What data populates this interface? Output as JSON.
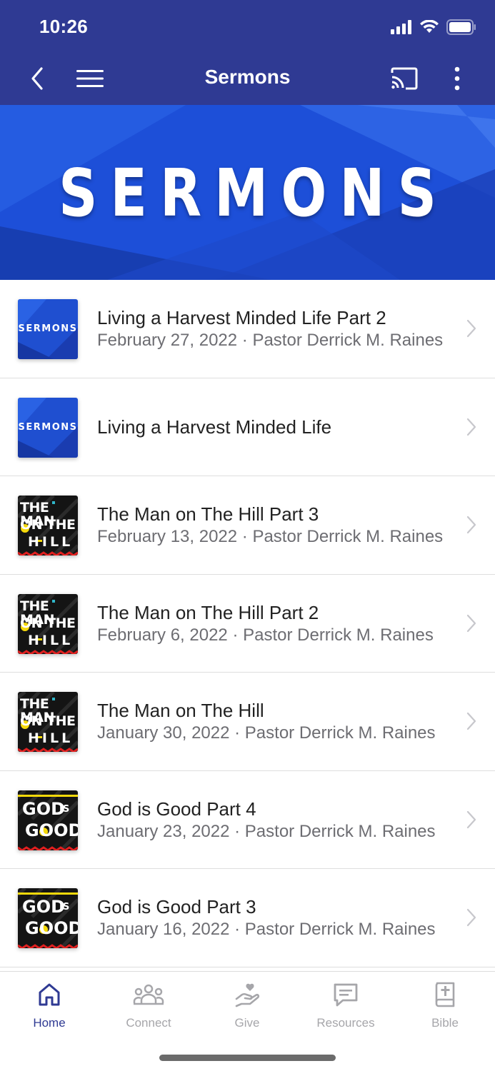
{
  "status_bar": {
    "time": "10:26"
  },
  "nav": {
    "title": "Sermons"
  },
  "banner": {
    "title": "SERMONS"
  },
  "thumbs": {
    "sermons_label": "SERMONS",
    "man_on_hill": {
      "line1": "THE MAN",
      "line2": "ON THE",
      "line3": "HILL"
    },
    "god_is_good": {
      "line1": "GOD",
      "is": "IS",
      "line2": "GOOD"
    }
  },
  "sermons": [
    {
      "title": "Living a Harvest Minded Life Part 2",
      "subtitle": "February 27, 2022 · Pastor Derrick M. Raines",
      "thumb": "sermons"
    },
    {
      "title": "Living a Harvest Minded Life",
      "subtitle": "",
      "thumb": "sermons"
    },
    {
      "title": "The Man on The Hill Part 3",
      "subtitle": "February 13, 2022 · Pastor Derrick M. Raines",
      "thumb": "man-on-hill"
    },
    {
      "title": "The Man on The Hill Part 2",
      "subtitle": "February 6, 2022 · Pastor Derrick M. Raines",
      "thumb": "man-on-hill"
    },
    {
      "title": "The Man on The Hill",
      "subtitle": "January 30, 2022 · Pastor Derrick M. Raines",
      "thumb": "man-on-hill"
    },
    {
      "title": "God is Good Part 4",
      "subtitle": "January 23, 2022 · Pastor Derrick M. Raines",
      "thumb": "god-is-good"
    },
    {
      "title": "God is Good Part 3",
      "subtitle": "January 16, 2022 · Pastor Derrick M. Raines",
      "thumb": "god-is-good"
    }
  ],
  "tabs": [
    {
      "label": "Home",
      "icon": "home-icon",
      "active": true
    },
    {
      "label": "Connect",
      "icon": "people-icon",
      "active": false
    },
    {
      "label": "Give",
      "icon": "give-heart-hand-icon",
      "active": false
    },
    {
      "label": "Resources",
      "icon": "chat-bubble-icon",
      "active": false
    },
    {
      "label": "Bible",
      "icon": "bible-icon",
      "active": false
    }
  ],
  "colors": {
    "nav_bg": "#2f3a93",
    "banner_blue": "#1d4fd8",
    "active_tab": "#2f3a93",
    "inactive_tab": "#a6a6aa"
  }
}
